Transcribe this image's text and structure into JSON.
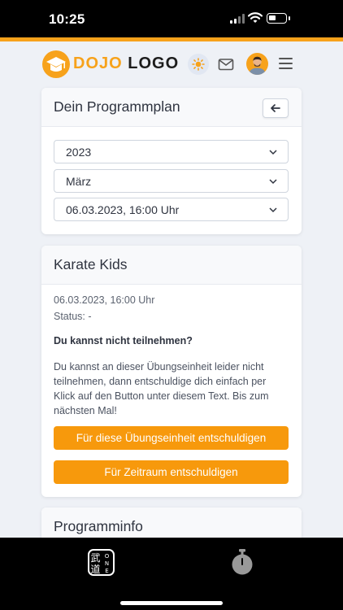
{
  "status_bar": {
    "time": "10:25",
    "battery_level": 0.45
  },
  "header": {
    "logo_text_1": "DOJO",
    "logo_text_2": "LOGO",
    "icons": [
      "graduation-cap-icon",
      "sun-icon",
      "mail-icon",
      "avatar",
      "hamburger-menu-icon"
    ]
  },
  "program_plan": {
    "title": "Dein Programmplan",
    "back_icon": "arrow-left-icon",
    "year_select": "2023",
    "month_select": "März",
    "date_select": "06.03.2023, 16:00 Uhr"
  },
  "session_card": {
    "title": "Karate Kids",
    "datetime": "06.03.2023, 16:00 Uhr",
    "status": "Status: -",
    "notice_heading": "Du kannst nicht teilnehmen?",
    "notice_text": "Du kannst an dieser Übungseinheit leider nicht teilnehmen, dann entschuldige dich einfach per Klick auf den Button unter diesem Text. Bis zum nächsten Mal!",
    "excuse_session_button": "Für diese Übungseinheit entschuldigen",
    "excuse_period_button": "Für Zeitraum entschuldigen"
  },
  "program_info": {
    "title": "Programminfo"
  },
  "bottom_nav": {
    "dojo_one_kanji_1": "武",
    "dojo_one_kanji_2": "道",
    "dojo_one_letters": "ONE",
    "icons": [
      "dojo-one-icon",
      "stopwatch-icon"
    ]
  },
  "colors": {
    "accent": "#f7a21b",
    "button": "#f7990c",
    "background": "#eef1f6"
  }
}
